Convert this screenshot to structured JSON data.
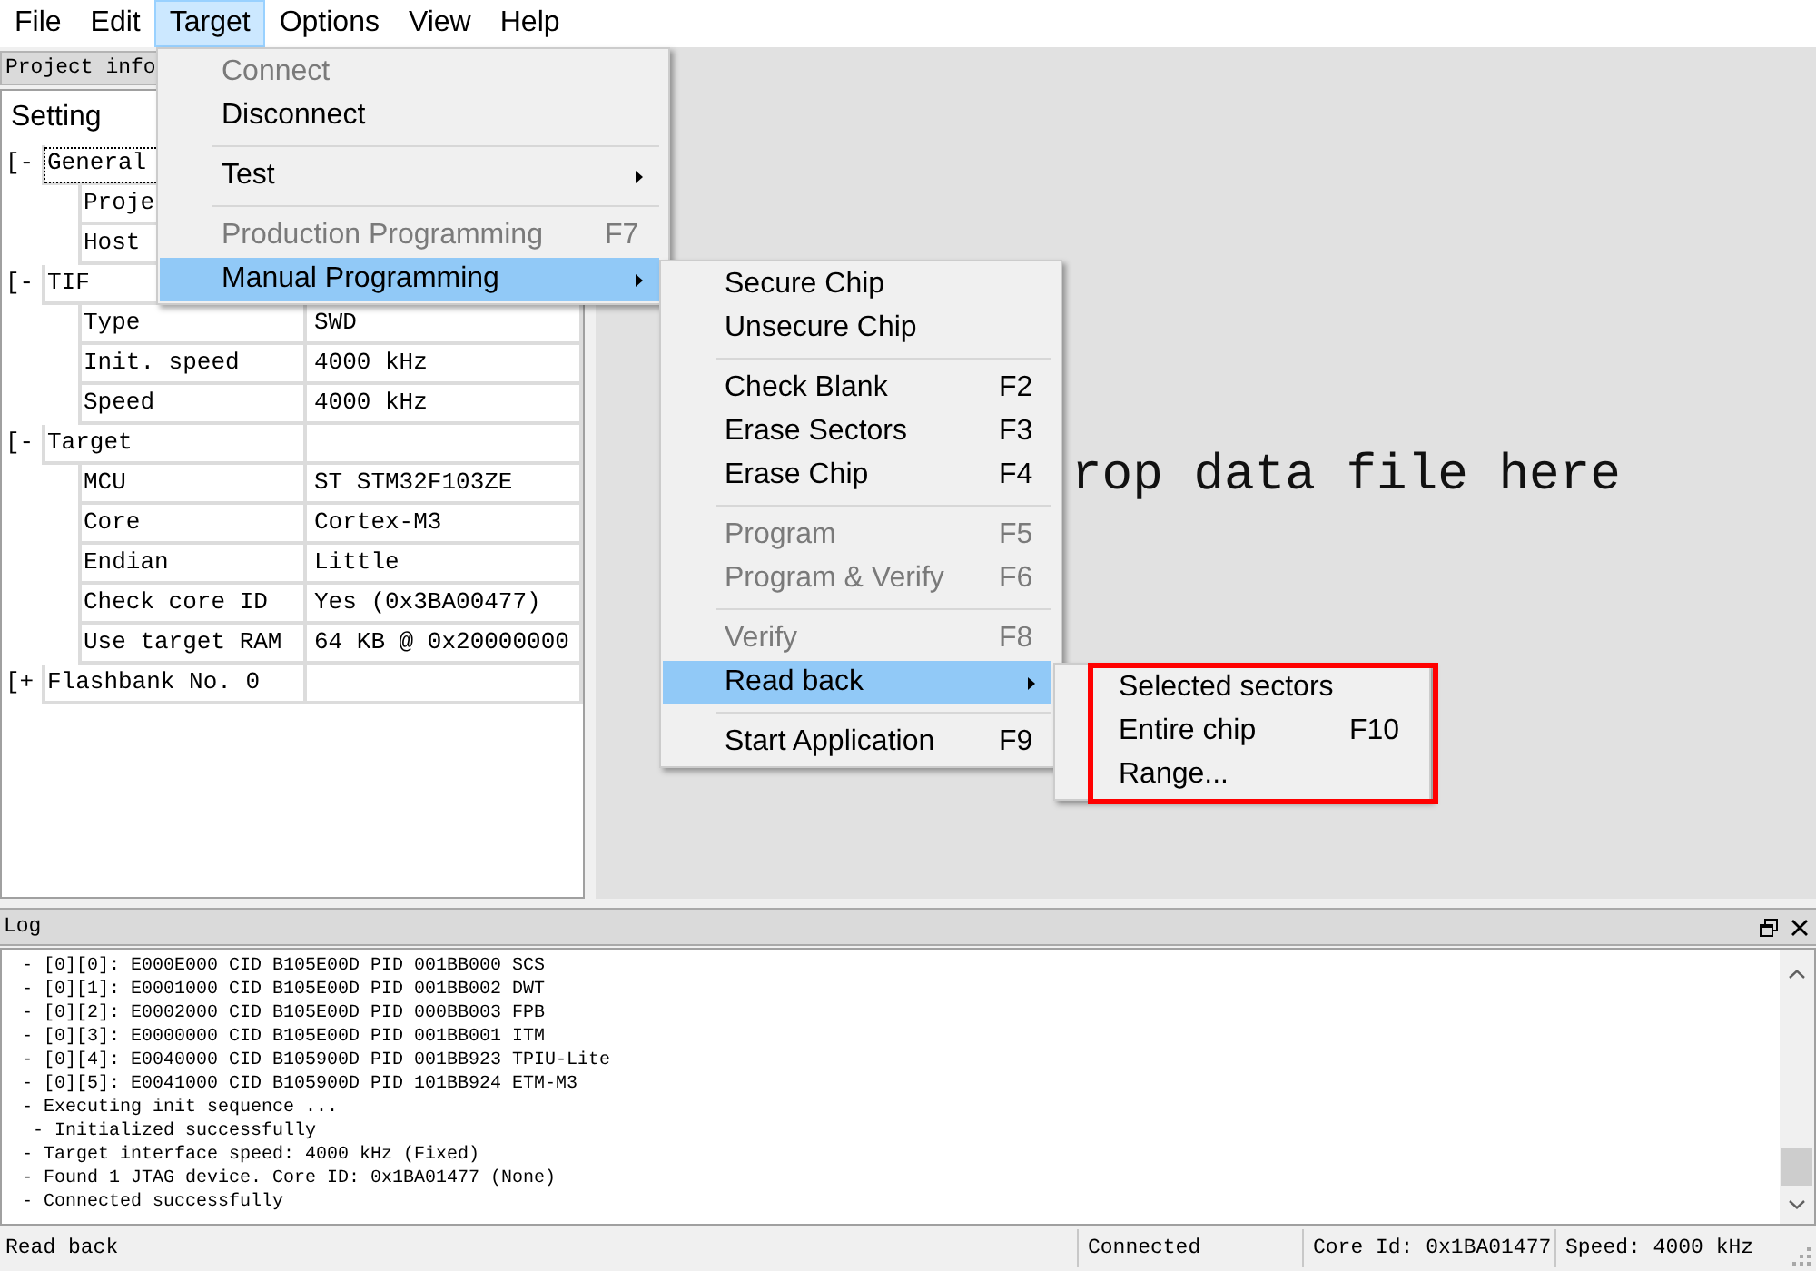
{
  "menu_bar": [
    {
      "label": "File",
      "selected": false
    },
    {
      "label": "Edit",
      "selected": false
    },
    {
      "label": "Target",
      "selected": true
    },
    {
      "label": "Options",
      "selected": false
    },
    {
      "label": "View",
      "selected": false
    },
    {
      "label": "Help",
      "selected": false
    }
  ],
  "project_panel": {
    "title": "Project info",
    "column_header": "Setting",
    "groups": [
      {
        "marker": "[-",
        "label": "General",
        "focused": true,
        "children": [
          {
            "name": "Proje"
          },
          {
            "name": "Host"
          }
        ]
      },
      {
        "marker": "[-",
        "label": "TIF",
        "focused": false,
        "children": [
          {
            "name": "Type",
            "value": "SWD"
          },
          {
            "name": "Init. speed",
            "value": "4000 kHz"
          },
          {
            "name": "Speed",
            "value": "4000 kHz"
          }
        ]
      },
      {
        "marker": "[-",
        "label": "Target",
        "focused": false,
        "children": [
          {
            "name": "MCU",
            "value": "ST STM32F103ZE"
          },
          {
            "name": "Core",
            "value": "Cortex-M3"
          },
          {
            "name": "Endian",
            "value": "Little"
          },
          {
            "name": "Check core ID",
            "value": "Yes (0x3BA00477)"
          },
          {
            "name": "Use target RAM",
            "value": "64 KB @ 0x20000000"
          }
        ]
      },
      {
        "marker": "[+",
        "label": "Flashbank No. 0",
        "focused": false
      }
    ]
  },
  "drop_area": {
    "hint": "rop data file here"
  },
  "target_menu": [
    {
      "kind": "item",
      "label": "Connect",
      "disabled": true,
      "selected": false,
      "submenu": false
    },
    {
      "kind": "item",
      "label": "Disconnect",
      "disabled": false,
      "selected": false,
      "submenu": false
    },
    {
      "kind": "separator"
    },
    {
      "kind": "item",
      "label": "Test",
      "disabled": false,
      "selected": false,
      "submenu": true
    },
    {
      "kind": "separator"
    },
    {
      "kind": "item",
      "label": "Production Programming",
      "shortcut": "F7",
      "disabled": true,
      "selected": false,
      "submenu": false
    },
    {
      "kind": "item",
      "label": "Manual Programming",
      "disabled": false,
      "selected": true,
      "submenu": true
    }
  ],
  "manual_programming_menu": [
    {
      "kind": "item",
      "label": "Secure Chip",
      "disabled": false,
      "selected": false,
      "submenu": false
    },
    {
      "kind": "item",
      "label": "Unsecure Chip",
      "disabled": false,
      "selected": false,
      "submenu": false
    },
    {
      "kind": "separator"
    },
    {
      "kind": "item",
      "label": "Check Blank",
      "shortcut": "F2",
      "disabled": false,
      "selected": false,
      "submenu": false
    },
    {
      "kind": "item",
      "label": "Erase Sectors",
      "shortcut": "F3",
      "disabled": false,
      "selected": false,
      "submenu": false
    },
    {
      "kind": "item",
      "label": "Erase Chip",
      "shortcut": "F4",
      "disabled": false,
      "selected": false,
      "submenu": false
    },
    {
      "kind": "separator"
    },
    {
      "kind": "item",
      "label": "Program",
      "shortcut": "F5",
      "disabled": true,
      "selected": false,
      "submenu": false
    },
    {
      "kind": "item",
      "label": "Program & Verify",
      "shortcut": "F6",
      "disabled": true,
      "selected": false,
      "submenu": false
    },
    {
      "kind": "separator"
    },
    {
      "kind": "item",
      "label": "Verify",
      "shortcut": "F8",
      "disabled": true,
      "selected": false,
      "submenu": false
    },
    {
      "kind": "item",
      "label": "Read back",
      "disabled": false,
      "selected": true,
      "submenu": true
    },
    {
      "kind": "separator"
    },
    {
      "kind": "item",
      "label": "Start Application",
      "shortcut": "F9",
      "disabled": false,
      "selected": false,
      "submenu": false
    }
  ],
  "read_back_menu": [
    {
      "kind": "item",
      "label": "Selected sectors",
      "disabled": false,
      "selected": false,
      "submenu": false
    },
    {
      "kind": "item",
      "label": "Entire chip",
      "shortcut": "F10",
      "disabled": false,
      "selected": false,
      "submenu": false
    },
    {
      "kind": "item",
      "label": "Range...",
      "disabled": false,
      "selected": false,
      "submenu": false
    }
  ],
  "log": {
    "title": "Log",
    "lines": [
      "- [0][0]: E000E000 CID B105E00D PID 001BB000 SCS",
      "- [0][1]: E0001000 CID B105E00D PID 001BB002 DWT",
      "- [0][2]: E0002000 CID B105E00D PID 000BB003 FPB",
      "- [0][3]: E0000000 CID B105E00D PID 001BB001 ITM",
      "- [0][4]: E0040000 CID B105900D PID 001BB923 TPIU-Lite",
      "- [0][5]: E0041000 CID B105900D PID 101BB924 ETM-M3",
      "- Executing init sequence ...",
      " - Initialized successfully",
      "- Target interface speed: 4000 kHz (Fixed)",
      "- Found 1 JTAG device. Core ID: 0x1BA01477 (None)",
      "- Connected successfully"
    ]
  },
  "status_bar": {
    "message": "Read back",
    "connection": "Connected",
    "core_id": "Core Id: 0x1BA01477",
    "speed": "Speed: 4000 kHz"
  }
}
